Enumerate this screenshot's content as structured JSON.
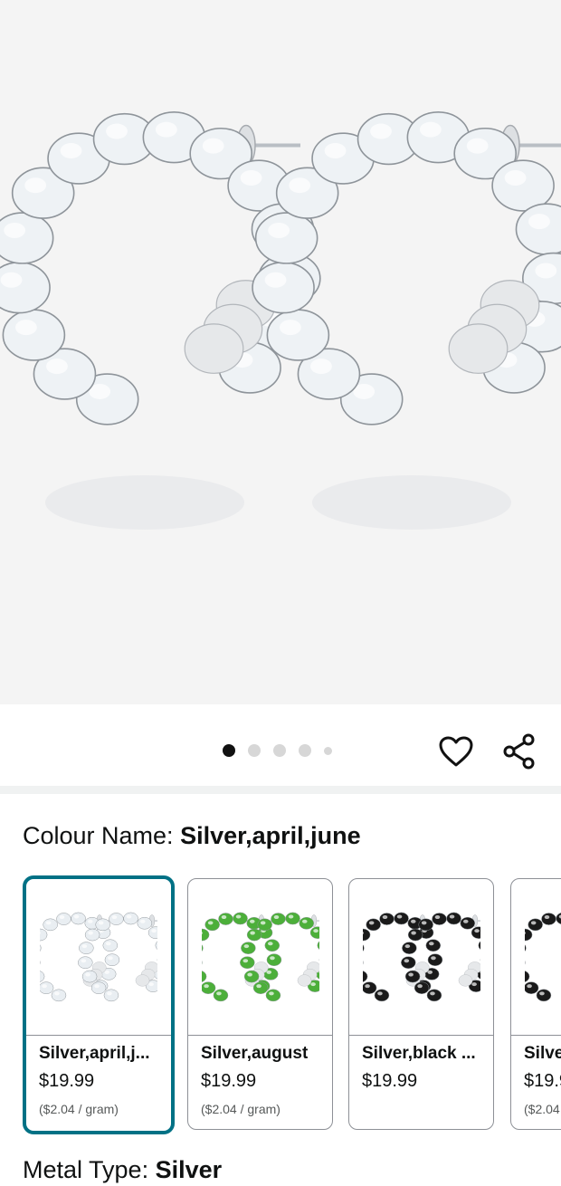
{
  "pagination": {
    "total_dots": 5,
    "active_index": 0
  },
  "actions": {
    "wishlist_icon": "heart-icon",
    "share_icon": "share-icon"
  },
  "colour": {
    "label": "Colour Name: ",
    "value": "Silver,april,june"
  },
  "swatches": [
    {
      "name": "Silver,april,j...",
      "price": "$19.99",
      "unit": "($2.04 / gram)",
      "stone_color": "#e9eef2",
      "selected": true
    },
    {
      "name": "Silver,august",
      "price": "$19.99",
      "unit": "($2.04 / gram)",
      "stone_color": "#4caf3a",
      "selected": false
    },
    {
      "name": "Silver,black ...",
      "price": "$19.99",
      "unit": "",
      "stone_color": "#1a1a1a",
      "selected": false
    },
    {
      "name": "Silve",
      "price": "$19.9",
      "unit": "($2.04",
      "stone_color": "#1a1a1a",
      "selected": false
    }
  ],
  "metal": {
    "label": "Metal Type: ",
    "value": "Silver"
  }
}
